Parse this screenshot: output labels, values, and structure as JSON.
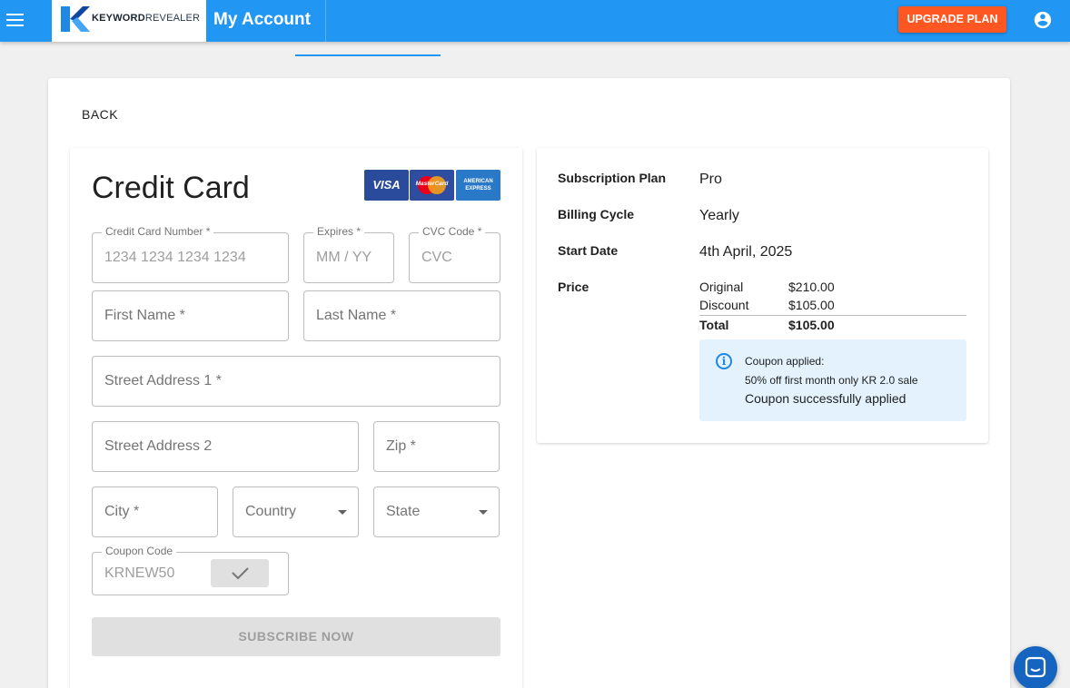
{
  "header": {
    "logo": {
      "brand_bold": "KEYWORD",
      "brand_light": "REVEALER",
      "logo_icon": "keywordrevealer-k-icon"
    },
    "title": "My Account",
    "upgrade_label": "UPGRADE PLAN",
    "menu_icon": "hamburger-menu-icon",
    "account_icon": "account-circle-icon",
    "colors": {
      "bar": "#2196f3",
      "upgrade": "#ff5722"
    }
  },
  "back_label": "BACK",
  "credit_card": {
    "title": "Credit Card",
    "card_logos": [
      "VISA",
      "MasterCard",
      "AMERICAN EXPRESS"
    ],
    "fields": {
      "card_number": {
        "label": "Credit Card Number *",
        "placeholder": "1234 1234 1234 1234"
      },
      "expires": {
        "label": "Expires *",
        "placeholder": "MM / YY"
      },
      "cvc": {
        "label": "CVC Code *",
        "placeholder": "CVC"
      },
      "first_name": {
        "placeholder": "First Name *"
      },
      "last_name": {
        "placeholder": "Last Name *"
      },
      "street1": {
        "placeholder": "Street Address 1 *"
      },
      "street2": {
        "placeholder": "Street Address 2"
      },
      "zip": {
        "placeholder": "Zip *"
      },
      "city": {
        "placeholder": "City *"
      },
      "country": {
        "placeholder": "Country"
      },
      "state": {
        "placeholder": "State"
      },
      "coupon": {
        "label": "Coupon Code",
        "value": "KRNEW50"
      }
    },
    "subscribe_label": "SUBSCRIBE NOW"
  },
  "summary": {
    "rows": [
      {
        "label": "Subscription Plan",
        "value": "Pro"
      },
      {
        "label": "Billing Cycle",
        "value": "Yearly"
      },
      {
        "label": "Start Date",
        "value": "4th April, 2025"
      }
    ],
    "price_label": "Price",
    "price_rows": [
      {
        "label": "Original",
        "amount": "$210.00"
      },
      {
        "label": "Discount",
        "amount": "$105.00"
      },
      {
        "label": "Total",
        "amount": "$105.00"
      }
    ],
    "coupon_info": {
      "line1": "Coupon applied:",
      "line2": "50% off first month only KR 2.0 sale",
      "line3": "Coupon successfully applied"
    }
  }
}
